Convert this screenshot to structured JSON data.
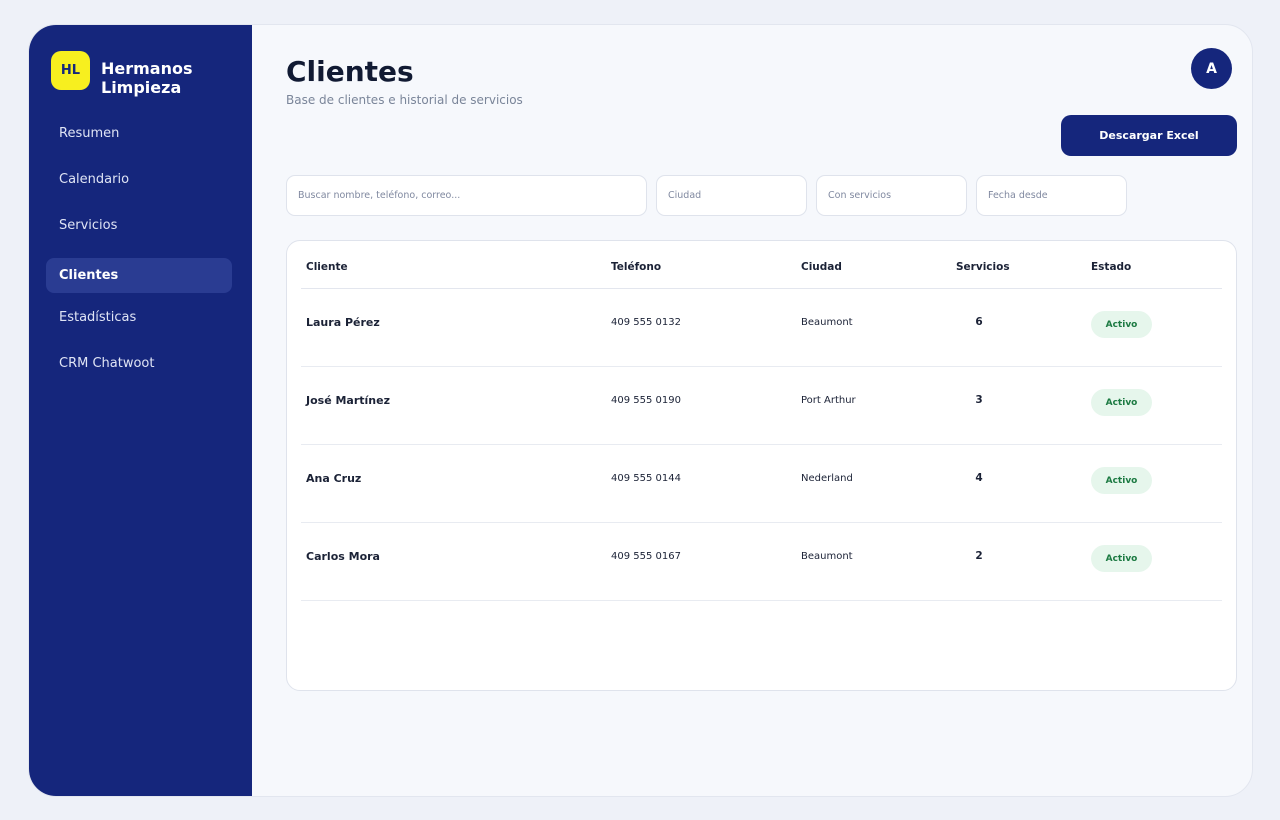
{
  "brand": {
    "initials": "HL",
    "name": "Hermanos Limpieza"
  },
  "nav": {
    "items": [
      {
        "label": "Resumen"
      },
      {
        "label": "Calendario"
      },
      {
        "label": "Servicios"
      },
      {
        "label": "Clientes",
        "active": true
      },
      {
        "label": "Estadísticas"
      },
      {
        "label": "CRM Chatwoot"
      }
    ]
  },
  "header": {
    "title": "Clientes",
    "subtitle": "Base de clientes e historial de servicios",
    "avatar_initial": "A",
    "download_label": "Descargar Excel"
  },
  "filters": {
    "search_placeholder": "Buscar nombre, teléfono, correo...",
    "city_placeholder": "Ciudad",
    "services_placeholder": "Con servicios",
    "date_placeholder": "Fecha desde"
  },
  "table": {
    "columns": [
      "Cliente",
      "Teléfono",
      "Ciudad",
      "Servicios",
      "Estado"
    ],
    "rows": [
      {
        "name": "Laura Pérez",
        "phone": "409 555 0132",
        "city": "Beaumont",
        "services": "6",
        "status": "Activo"
      },
      {
        "name": "José Martínez",
        "phone": "409 555 0190",
        "city": "Port Arthur",
        "services": "3",
        "status": "Activo"
      },
      {
        "name": "Ana Cruz",
        "phone": "409 555 0144",
        "city": "Nederland",
        "services": "4",
        "status": "Activo"
      },
      {
        "name": "Carlos Mora",
        "phone": "409 555 0167",
        "city": "Beaumont",
        "services": "2",
        "status": "Activo"
      }
    ]
  },
  "colors": {
    "sidebar": "#15267c",
    "logo_badge": "#f7ef1f",
    "active_nav": "#2a3c92",
    "status_badge_bg": "#e6f6ec",
    "status_badge_text": "#1c7a42"
  }
}
